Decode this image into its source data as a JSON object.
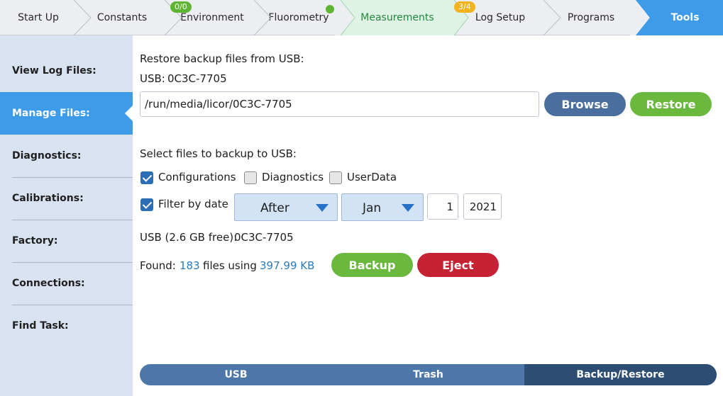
{
  "topbar": {
    "tabs": [
      {
        "label": "Start Up"
      },
      {
        "label": "Constants"
      },
      {
        "label": "Environment",
        "badge": "0/0"
      },
      {
        "label": "Fluorometry"
      },
      {
        "label": "Measurements"
      },
      {
        "label": "Log Setup",
        "badge": "3/4"
      },
      {
        "label": "Programs"
      },
      {
        "label": "Tools"
      }
    ]
  },
  "sidebar": {
    "items": [
      {
        "label": "View Log Files:"
      },
      {
        "label": "Manage Files:"
      },
      {
        "label": "Diagnostics:"
      },
      {
        "label": "Calibrations:"
      },
      {
        "label": "Factory:"
      },
      {
        "label": "Connections:"
      },
      {
        "label": "Find Task:"
      }
    ],
    "active": "Manage Files:"
  },
  "restore": {
    "heading": "Restore backup files from USB:",
    "usb_label": "USB:",
    "usb_id": "0C3C-7705",
    "path_value": "/run/media/licor/0C3C-7705",
    "browse_label": "Browse",
    "restore_label": "Restore"
  },
  "backup": {
    "heading": "Select files to backup to USB:",
    "options": [
      {
        "label": "Configurations",
        "checked": true
      },
      {
        "label": "Diagnostics",
        "checked": false
      },
      {
        "label": "UserData",
        "checked": false
      }
    ],
    "filter_label": "Filter by date",
    "filter_checked": true,
    "when": "After",
    "month": "Jan",
    "day": "1",
    "year": "2021",
    "usb_free_label": "USB (2.6 GB free):",
    "usb_free_id": "0C3C-7705",
    "found_label": "Found:",
    "found_count": "183",
    "files_using_label": "files using",
    "found_size": "397.99 KB",
    "backup_label": "Backup",
    "eject_label": "Eject"
  },
  "bottom_tabs": {
    "items": [
      {
        "label": "USB"
      },
      {
        "label": "Trash"
      },
      {
        "label": "Backup/Restore"
      }
    ],
    "selected": "Backup/Restore"
  },
  "colors": {
    "accent": "#3d9be9",
    "measurement_tab": "#dff2e6",
    "sidebar_bg": "#d8e2f0",
    "button_blue": "#4a6f9f",
    "button_green": "#6bb83f",
    "button_red": "#c72234",
    "link_blue": "#2b7bbd"
  }
}
